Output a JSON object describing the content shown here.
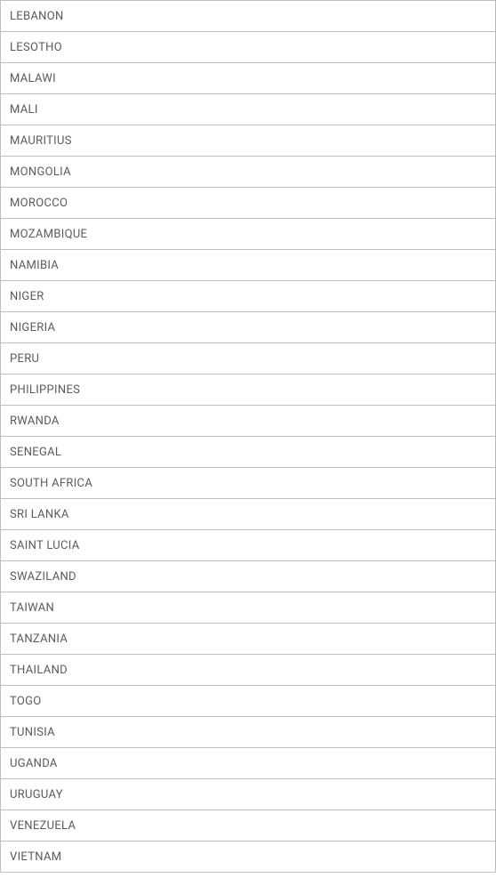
{
  "countries": [
    "LEBANON",
    "LESOTHO",
    "MALAWI",
    "MALI",
    "MAURITIUS",
    "MONGOLIA",
    "MOROCCO",
    "MOZAMBIQUE",
    "NAMIBIA",
    "NIGER",
    "NIGERIA",
    "PERU",
    "PHILIPPINES",
    "RWANDA",
    "SENEGAL",
    "SOUTH AFRICA",
    "SRI LANKA",
    "SAINT LUCIA",
    "SWAZILAND",
    "TAIWAN",
    "TANZANIA",
    "THAILAND",
    "TOGO",
    "TUNISIA",
    "UGANDA",
    "URUGUAY",
    "VENEZUELA",
    "VIETNAM"
  ]
}
